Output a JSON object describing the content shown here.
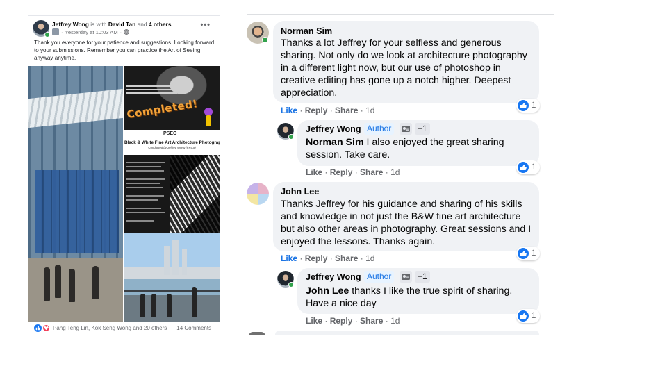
{
  "post": {
    "author": "Jeffrey Wong",
    "with_text": "is with",
    "tagged": "David Tan",
    "and_text": "and",
    "others": "4 others",
    "period": ".",
    "timestamp": "Yesterday at 10:03 AM",
    "more_label": "•••",
    "text": "Thank you everyone for your patience and suggestions. Looking forward to your submissions.  Remember you can practice the Art of Seeing anyway anytime.",
    "poster": {
      "completed_text": "Completed!",
      "logo_text": "PSEO",
      "title": "Black & White Fine Art Architecture Photography",
      "subtitle": "Conducted by Jeffrey Wong (FPSS)"
    },
    "reactions_text": "Pang Teng Lin, Kok Seng Wong and 20 others",
    "comments_count": "14 Comments"
  },
  "comments": [
    {
      "name": "Norman Sim",
      "text": "Thanks a lot Jeffrey for your selfless and generous sharing. Not only do we look at architecture photography in a different light now, but our use of photoshop in creative editing has gone up a notch higher. Deepest appreciation.",
      "like": "Like",
      "reply": "Reply",
      "share": "Share",
      "time": "1d",
      "reaction_count": "1"
    },
    {
      "name": "Jeffrey Wong",
      "badge": "Author",
      "plus": "+1",
      "mention": "Norman Sim",
      "text": " I also enjoyed the great sharing session. Take care.",
      "like": "Like",
      "reply": "Reply",
      "share": "Share",
      "time": "1d",
      "reaction_count": "1"
    },
    {
      "name": "John Lee",
      "text": "Thanks Jeffrey for his guidance and sharing of his skills and knowledge in not just the B&W fine art architecture but also other areas in photography. Great sessions and I enjoyed the lessons. Thanks again.",
      "like": "Like",
      "reply": "Reply",
      "share": "Share",
      "time": "1d",
      "reaction_count": "1"
    },
    {
      "name": "Jeffrey Wong",
      "badge": "Author",
      "plus": "+1",
      "mention": "John Lee",
      "text": " thanks I like the true spirit of sharing. Have a nice day",
      "like": "Like",
      "reply": "Reply",
      "share": "Share",
      "time": "1d",
      "reaction_count": "1"
    }
  ],
  "action_separator": " · ",
  "colors": {
    "link_blue": "#1b74e4",
    "bubble": "#f0f2f5",
    "muted": "#65676b",
    "online": "#31a24c"
  }
}
